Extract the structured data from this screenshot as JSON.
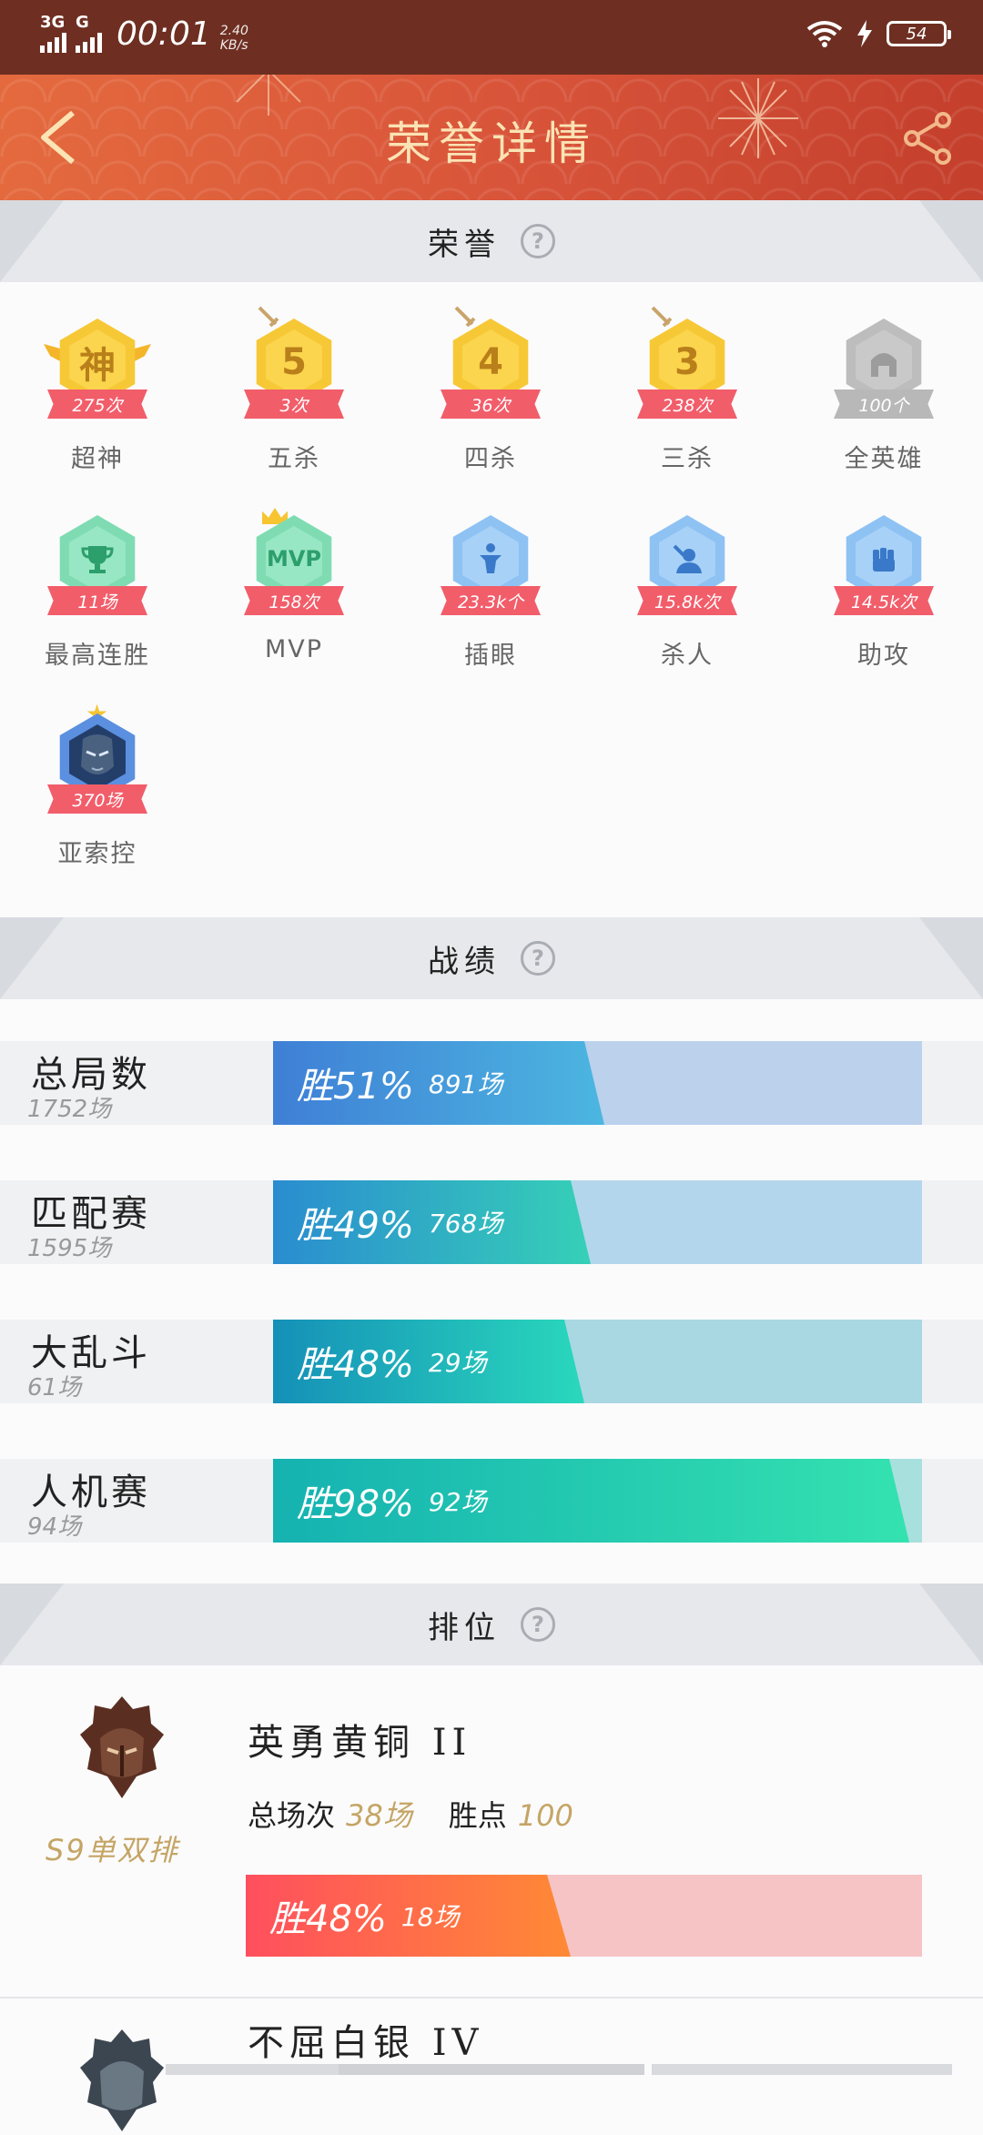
{
  "status_bar": {
    "network_1": "3G",
    "network_2": "G",
    "time": "00:01",
    "speed_value": "2.40",
    "speed_unit": "KB/s",
    "battery": "54"
  },
  "header": {
    "title": "荣誉详情",
    "colors": {
      "start": "#e46a3e",
      "end": "#c43f2c",
      "title": "#fbe3b4"
    }
  },
  "sections": {
    "honors": "荣誉",
    "records": "战绩",
    "ranking": "排位"
  },
  "honors": [
    {
      "icon": "神",
      "badge": "275次",
      "label": "超神",
      "style": "gold"
    },
    {
      "icon": "5",
      "badge": "3次",
      "label": "五杀",
      "style": "gold"
    },
    {
      "icon": "4",
      "badge": "36次",
      "label": "四杀",
      "style": "gold"
    },
    {
      "icon": "3",
      "badge": "238次",
      "label": "三杀",
      "style": "gold"
    },
    {
      "icon": "helmet",
      "badge": "100个",
      "label": "全英雄",
      "style": "gray"
    },
    {
      "icon": "trophy",
      "badge": "11场",
      "label": "最高连胜",
      "style": "green"
    },
    {
      "icon": "MVP",
      "badge": "158次",
      "label": "MVP",
      "style": "green"
    },
    {
      "icon": "ward",
      "badge": "23.3k个",
      "label": "插眼",
      "style": "blue"
    },
    {
      "icon": "kill",
      "badge": "15.8k次",
      "label": "杀人",
      "style": "blue"
    },
    {
      "icon": "fist",
      "badge": "14.5k次",
      "label": "助攻",
      "style": "blue"
    },
    {
      "icon": "hero-portrait",
      "badge": "370场",
      "label": "亚索控",
      "style": "hero"
    }
  ],
  "records": [
    {
      "name": "总局数",
      "count": "1752场",
      "rate_label": "胜51%",
      "games": "891场",
      "win_rate": 51,
      "track": "#bcd1ec",
      "from": "#3f7fd6",
      "to": "#4cb6e0"
    },
    {
      "name": "匹配赛",
      "count": "1595场",
      "rate_label": "胜49%",
      "games": "768场",
      "win_rate": 49,
      "track": "#b4d6ec",
      "from": "#2a8cd0",
      "to": "#36d0b7"
    },
    {
      "name": "大乱斗",
      "count": "61场",
      "rate_label": "胜48%",
      "games": "29场",
      "win_rate": 48,
      "track": "#a9d7e2",
      "from": "#1590b8",
      "to": "#2ad8bc"
    },
    {
      "name": "人机赛",
      "count": "94场",
      "rate_label": "胜98%",
      "games": "92场",
      "win_rate": 98,
      "track": "#a8e0de",
      "from": "#15b2b1",
      "to": "#34e2b0"
    }
  ],
  "ranks": [
    {
      "season": "S9单双排",
      "tier": "英勇黄铜 II",
      "total_label": "总场次",
      "total_value": "38场",
      "points_label": "胜点",
      "points_value": "100",
      "rate_label": "胜48%",
      "games": "18场",
      "win_rate": 48
    },
    {
      "tier": "不屈白银 IV"
    }
  ]
}
